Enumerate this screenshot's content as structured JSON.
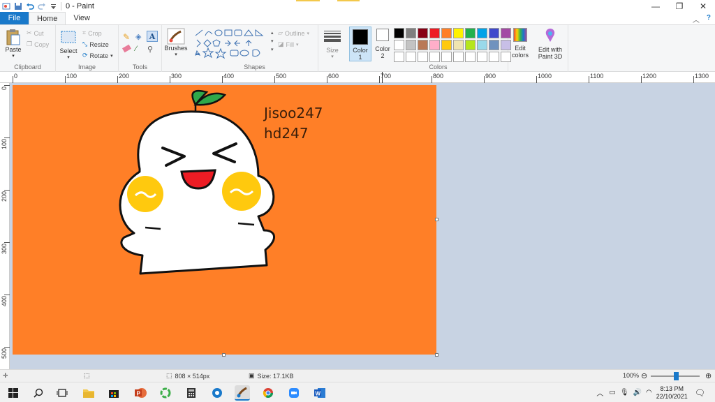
{
  "window": {
    "title": "0 - Paint",
    "controls": {
      "minimize": "—",
      "maximize": "❐",
      "close": "✕"
    }
  },
  "tabs": {
    "file": "File",
    "home": "Home",
    "view": "View"
  },
  "ribbon": {
    "clipboard": {
      "paste": "Paste",
      "cut": "Cut",
      "copy": "Copy",
      "label": "Clipboard"
    },
    "image": {
      "select": "Select",
      "crop": "Crop",
      "resize": "Resize",
      "rotate": "Rotate",
      "label": "Image"
    },
    "tools": {
      "label": "Tools"
    },
    "brushes": {
      "label": "Brushes"
    },
    "shapes": {
      "outline": "Outline",
      "fill": "Fill",
      "label": "Shapes"
    },
    "size": {
      "label": "Size"
    },
    "color1": {
      "line1": "Color",
      "line2": "1",
      "value": "#000000"
    },
    "color2": {
      "line1": "Color",
      "line2": "2",
      "value": "#ffffff"
    },
    "colors": {
      "label": "Colors"
    },
    "edit_colors": {
      "line1": "Edit",
      "line2": "colors"
    },
    "paint3d": {
      "line1": "Edit with",
      "line2": "Paint 3D"
    },
    "palette": [
      "#000000",
      "#7f7f7f",
      "#880015",
      "#ed1c24",
      "#ff7f27",
      "#fff200",
      "#22b14c",
      "#00a2e8",
      "#3f48cc",
      "#a349a4",
      "#ffffff",
      "#c3c3c3",
      "#b97a57",
      "#ffaec9",
      "#ffc90e",
      "#efe4b0",
      "#b5e61d",
      "#99d9ea",
      "#7092be",
      "#c8bfe7",
      "#ffffff",
      "#ffffff",
      "#ffffff",
      "#ffffff",
      "#ffffff",
      "#ffffff",
      "#ffffff",
      "#ffffff",
      "#ffffff",
      "#ffffff"
    ]
  },
  "ruler": {
    "h_labels": [
      "0",
      "100",
      "200",
      "300",
      "400",
      "500",
      "600",
      "700",
      "800",
      "900",
      "1000",
      "1100",
      "1200",
      "1300"
    ],
    "v_labels": [
      "0",
      "100",
      "200",
      "300",
      "400",
      "500"
    ]
  },
  "canvas": {
    "background": "#ff7f27",
    "text_line1": "Jisoo247",
    "text_line2": "hd247"
  },
  "status": {
    "dimensions": "808 × 514px",
    "size": "Size: 17.1KB",
    "zoom": "100%"
  },
  "taskbar": {
    "time": "8:13 PM",
    "date": "22/10/2021"
  }
}
